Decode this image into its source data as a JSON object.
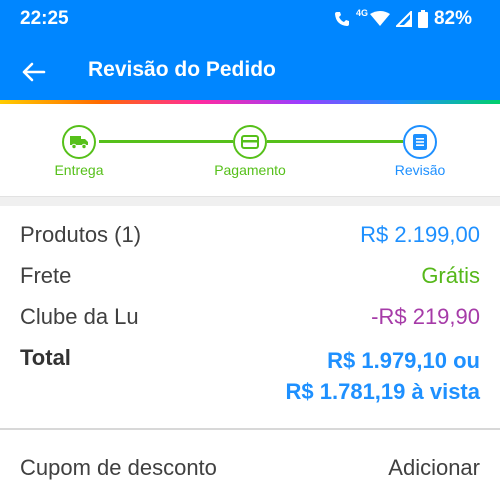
{
  "status_bar": {
    "time": "22:25",
    "network_tag": "4G",
    "battery": "82%",
    "icons": [
      "call-icon",
      "wifi-icon",
      "signal-icon",
      "battery-icon"
    ]
  },
  "app_bar": {
    "title": "Revisão do Pedido",
    "back_icon": "arrow-left-icon"
  },
  "stepper": {
    "steps": [
      {
        "label": "Entrega",
        "icon": "truck-icon",
        "state": "done"
      },
      {
        "label": "Pagamento",
        "icon": "card-icon",
        "state": "done"
      },
      {
        "label": "Revisão",
        "icon": "document-icon",
        "state": "current"
      }
    ]
  },
  "summary": {
    "products_label": "Produtos (1)",
    "products_value": "R$ 2.199,00",
    "shipping_label": "Frete",
    "shipping_value": "Grátis",
    "club_label": "Clube da Lu",
    "club_value": "-R$ 219,90",
    "total_label": "Total",
    "total_value_line1": "R$ 1.979,10 ou",
    "total_value_line2": "R$ 1.781,19 à vista"
  },
  "coupon": {
    "label": "Cupom de desconto",
    "action": "Adicionar"
  },
  "colors": {
    "primary_blue": "#0086ff",
    "link_blue": "#1e90ff",
    "green": "#56c01a",
    "purple": "#a63ba8"
  }
}
